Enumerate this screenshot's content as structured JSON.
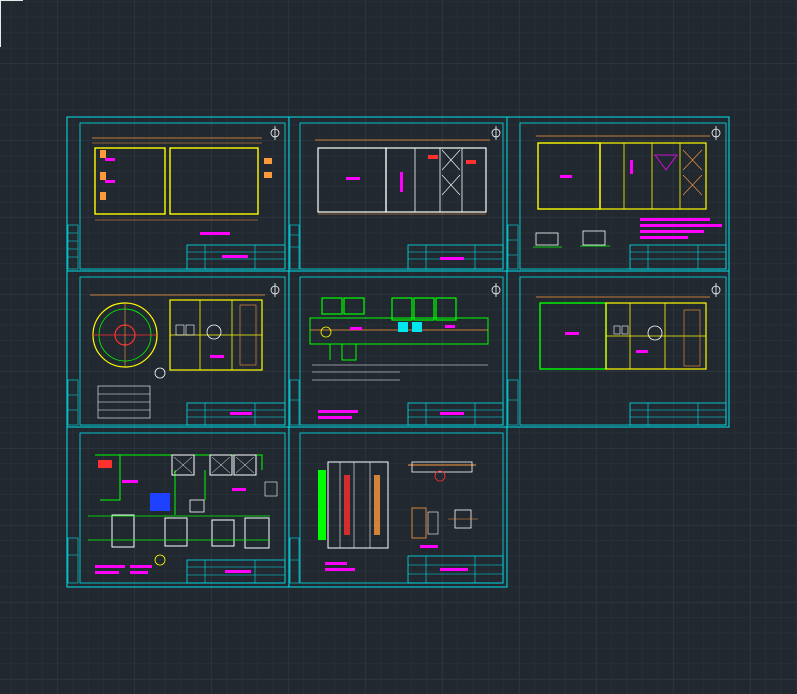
{
  "app": {
    "view": "model-space"
  },
  "colors": {
    "background": "#212830",
    "frame": "#00e5ee",
    "wall": "#ffff00",
    "dimension": "#ff9a3c",
    "text": "#ff00ff",
    "pipe": "#00ff00",
    "line": "#ffffff",
    "tank": "#ff3030",
    "fill_blue": "#1e40ff"
  },
  "sheets": [
    {
      "id": 1,
      "row": 1,
      "col": 1,
      "content": "tank-plan"
    },
    {
      "id": 2,
      "row": 1,
      "col": 2,
      "content": "building-section"
    },
    {
      "id": 3,
      "row": 1,
      "col": 3,
      "content": "building-section-detail"
    },
    {
      "id": 4,
      "row": 2,
      "col": 1,
      "content": "circular-clarifier-plan"
    },
    {
      "id": 5,
      "row": 2,
      "col": 2,
      "content": "pipe-layout-plan"
    },
    {
      "id": 6,
      "row": 2,
      "col": 3,
      "content": "building-plan"
    },
    {
      "id": 7,
      "row": 3,
      "col": 1,
      "content": "process-flow-diagram"
    },
    {
      "id": 8,
      "row": 3,
      "col": 2,
      "content": "equipment-details"
    }
  ]
}
